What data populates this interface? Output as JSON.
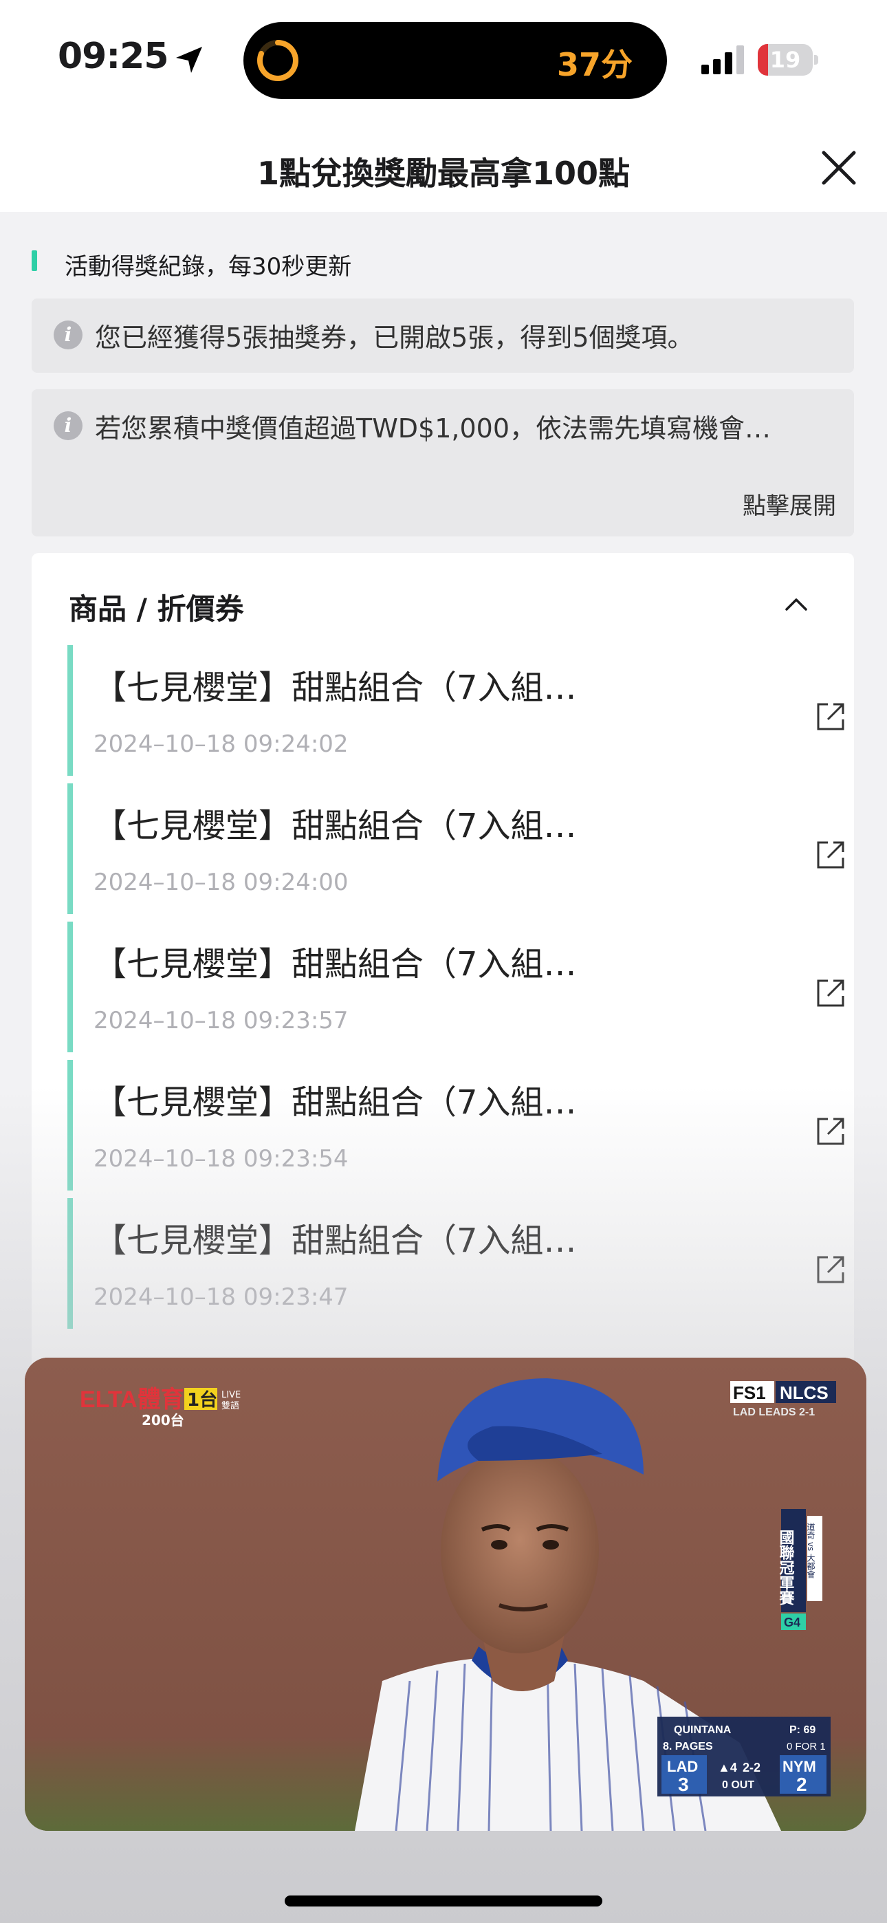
{
  "status": {
    "time": "09:25",
    "island_score": "37分",
    "battery": "19",
    "battery_level": 0.19,
    "accent_color": "#f7a42a"
  },
  "header": {
    "title": "1點兌換獎勵最高拿100點",
    "close_icon": "close-icon"
  },
  "section": {
    "label": "活動得獎紀錄，每30秒更新"
  },
  "info": [
    {
      "icon": "info-icon",
      "text": "您已經獲得5張抽獎券，已開啟5張，得到5個獎項。"
    },
    {
      "icon": "info-icon",
      "text": "若您累積中獎價值超過TWD$1,000，依法需先填寫機會…",
      "expand": "點擊展開"
    }
  ],
  "card": {
    "title": "商品 / 折價券",
    "chevron_icon": "chevron-up-icon",
    "records": [
      {
        "name": "【七見櫻堂】甜點組合（7入組…",
        "time": "2024–10–18 09:24:02"
      },
      {
        "name": "【七見櫻堂】甜點組合（7入組…",
        "time": "2024–10–18 09:24:00"
      },
      {
        "name": "【七見櫻堂】甜點組合（7入組…",
        "time": "2024–10–18 09:23:57"
      },
      {
        "name": "【七見櫻堂】甜點組合（7入組…",
        "time": "2024–10–18 09:23:54"
      },
      {
        "name": "【七見櫻堂】甜點組合（7入組…",
        "time": "2024–10–18 09:23:47"
      }
    ]
  },
  "pip": {
    "channel_logo": "ELTA體育",
    "channel_num": "1台",
    "live": "LIVE",
    "lang": "雙語",
    "channel_sub": "200台",
    "network": "FS1",
    "series": "NLCS",
    "series_status": "LAD LEADS 2-1",
    "banner": "國聯冠軍賽",
    "banner_teams": "道奇 vs 大都會",
    "game": "G4",
    "pitcher": "QUINTANA",
    "pitch_count": "P: 69",
    "batter": "8. PAGES",
    "batter_stat": "0 FOR 1",
    "away_team": "LAD",
    "away_score": "3",
    "home_team": "NYM",
    "home_score": "2",
    "inning": "▲4",
    "count": "2-2",
    "outs": "0 OUT"
  }
}
